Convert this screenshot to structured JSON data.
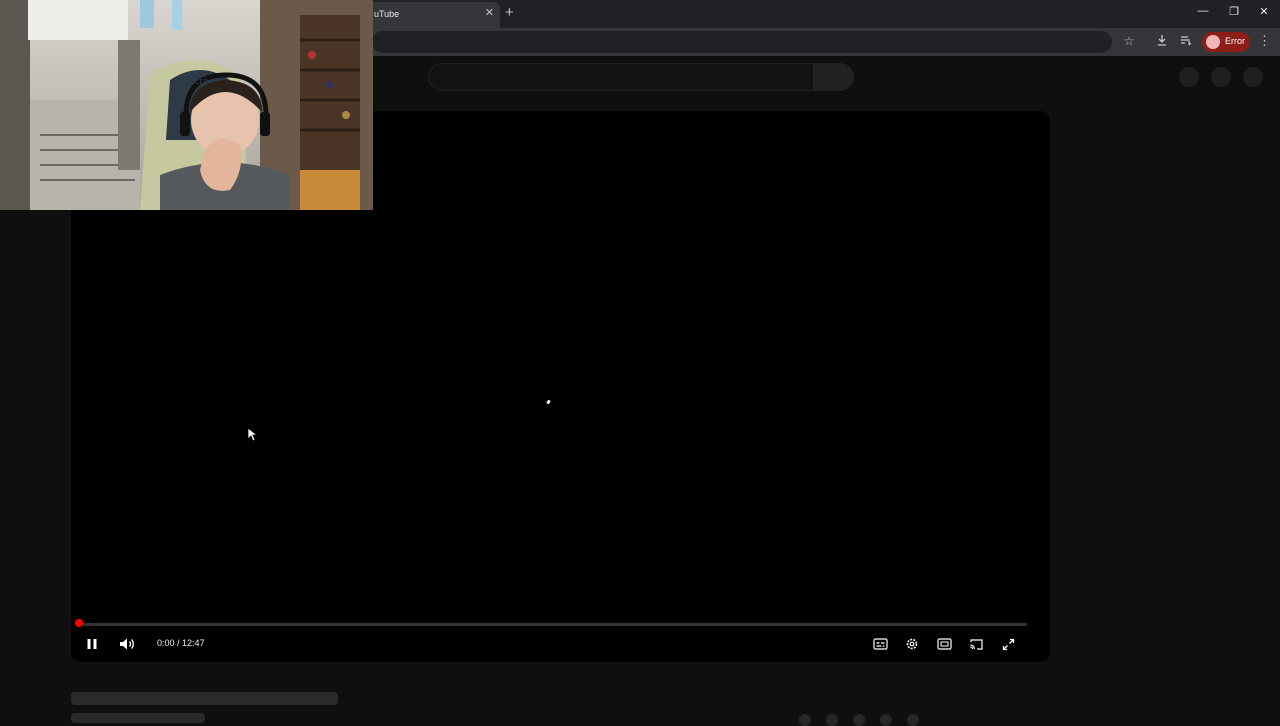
{
  "browser": {
    "tab_title": "uTube",
    "tab_close_glyph": "✕",
    "new_tab_glyph": "+",
    "window_controls": [
      "—",
      "❐",
      "✕"
    ],
    "toolbar_icons": [
      "star-icon",
      "download-icon",
      "reading-list-icon"
    ],
    "profile_status": "Error",
    "menu_glyph": "⋮"
  },
  "player": {
    "current_time": "0:00",
    "time_separator": " / ",
    "duration": "12:47",
    "progress": 0.0,
    "controls": [
      "pause-icon",
      "volume-icon",
      "subtitles-icon",
      "settings-icon",
      "miniplayer-icon",
      "cast-icon",
      "fullscreen-exit-icon"
    ],
    "accent_color": "#ff0000"
  },
  "colors": {
    "page_background": "#0f0f0f",
    "player_background": "#000000",
    "error_badge": "#8c1d18"
  }
}
